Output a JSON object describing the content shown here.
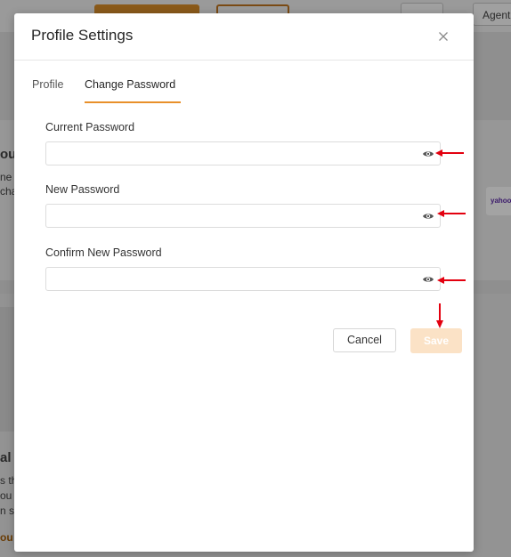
{
  "background": {
    "agent_label": "Agent",
    "yahoo_label": "yahoo",
    "partial_texts": [
      "ou",
      "ne",
      "cha",
      "al",
      "s th",
      "ou",
      "n sc",
      "ou"
    ]
  },
  "modal": {
    "title": "Profile Settings",
    "close_icon": "close-icon",
    "tabs": [
      {
        "label": "Profile",
        "active": false
      },
      {
        "label": "Change Password",
        "active": true
      }
    ],
    "fields": [
      {
        "label": "Current Password",
        "value": "",
        "placeholder": "",
        "icon": "eye-icon"
      },
      {
        "label": "New Password",
        "value": "",
        "placeholder": "",
        "icon": "eye-icon"
      },
      {
        "label": "Confirm New Password",
        "value": "",
        "placeholder": "",
        "icon": "eye-icon"
      }
    ],
    "buttons": {
      "cancel": "Cancel",
      "save": "Save"
    }
  },
  "colors": {
    "accent": "#e8902a",
    "save_disabled": "#fbe2c6",
    "annotation_arrow": "#e3000f"
  }
}
